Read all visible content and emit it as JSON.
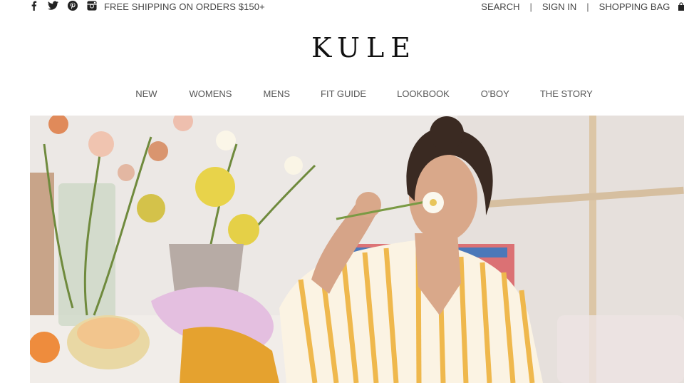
{
  "topbar": {
    "social_icons": [
      "facebook-icon",
      "twitter-icon",
      "pinterest-icon",
      "instagram-icon"
    ],
    "promo_text": "FREE SHIPPING ON ORDERS $150+",
    "search_label": "SEARCH",
    "separator": "|",
    "signin_label": "SIGN IN",
    "bag_label": "SHOPPING BAG"
  },
  "brand": {
    "logo_text": "KULE"
  },
  "nav": {
    "items": [
      {
        "label": "NEW"
      },
      {
        "label": "WOMENS"
      },
      {
        "label": "MENS"
      },
      {
        "label": "FIT GUIDE"
      },
      {
        "label": "LOOKBOOK"
      },
      {
        "label": "O'BOY"
      },
      {
        "label": "THE STORY"
      }
    ]
  },
  "hero": {
    "colors": {
      "wall": "#ebe7e4",
      "shirt_stripe": "#efb84d",
      "hair": "#3a2a22",
      "skin": "#d9a88a",
      "foliage": "#6f8a3d",
      "mimosa": "#e8d34a"
    }
  }
}
